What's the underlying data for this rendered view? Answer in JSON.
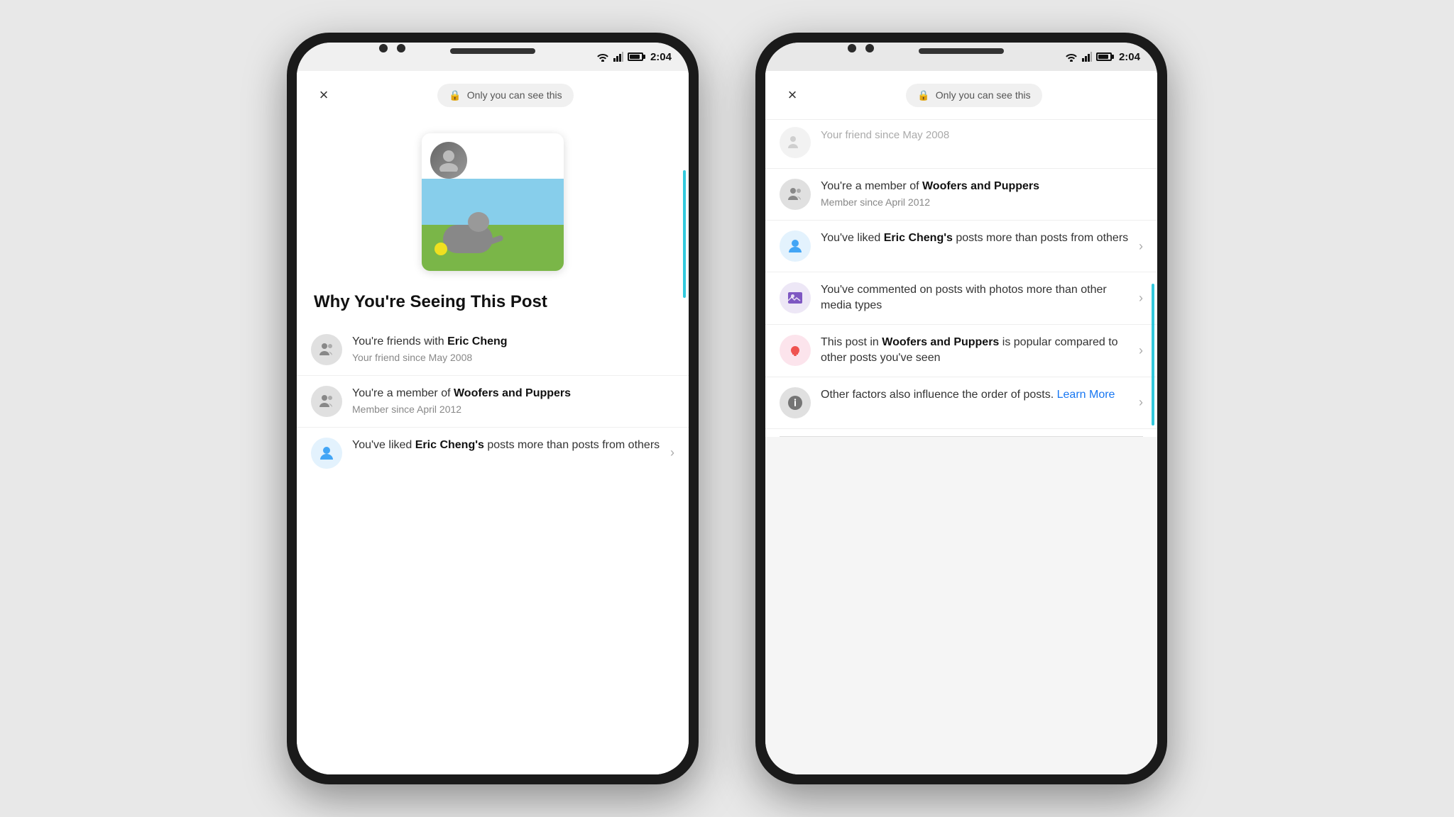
{
  "status": {
    "time": "2:04"
  },
  "privacy": {
    "label": "Only you can see this"
  },
  "phone1": {
    "heading": "Why You're Seeing This Post",
    "reasons": [
      {
        "id": "friends",
        "text_before": "You're friends with ",
        "bold": "Eric Cheng",
        "text_after": "",
        "sub": "Your friend since May 2008",
        "has_chevron": false,
        "icon_type": "people",
        "icon_bg": "gray"
      },
      {
        "id": "member",
        "text_before": "You're a member of ",
        "bold": "Woofers and Puppers",
        "text_after": "",
        "sub": "Member since April 2012",
        "has_chevron": false,
        "icon_type": "people",
        "icon_bg": "gray"
      },
      {
        "id": "liked",
        "text_before": "You've liked ",
        "bold": "Eric Cheng's",
        "text_after": " posts more than posts from others",
        "sub": "",
        "has_chevron": true,
        "icon_type": "person",
        "icon_bg": "blue"
      }
    ]
  },
  "phone2": {
    "partial_top": {
      "sub": "Your friend since May 2008"
    },
    "reasons": [
      {
        "id": "member2",
        "text_before": "You're a member of ",
        "bold": "Woofers and Puppers",
        "text_after": "",
        "sub": "Member since April 2012",
        "has_chevron": false,
        "icon_type": "people",
        "icon_bg": "gray"
      },
      {
        "id": "liked2",
        "text_before": "You've liked ",
        "bold": "Eric Cheng's",
        "text_after": " posts more than posts from others",
        "sub": "",
        "has_chevron": true,
        "icon_type": "person",
        "icon_bg": "blue"
      },
      {
        "id": "commented",
        "text_before": "You've commented on posts with photos more than other media types",
        "bold": "",
        "text_after": "",
        "sub": "",
        "has_chevron": true,
        "icon_type": "photo",
        "icon_bg": "purple"
      },
      {
        "id": "popular",
        "text_before": "This post in ",
        "bold": "Woofers and Puppers",
        "text_after": " is popular compared to other posts you've seen",
        "sub": "",
        "has_chevron": true,
        "icon_type": "popular",
        "icon_bg": "pink"
      },
      {
        "id": "other",
        "text_before": "Other factors also influence the order of posts. Learn More",
        "bold": "",
        "text_after": "",
        "sub": "",
        "has_chevron": true,
        "icon_type": "info",
        "icon_bg": "gray-dark"
      }
    ]
  },
  "close_label": "×",
  "chevron_label": "›"
}
